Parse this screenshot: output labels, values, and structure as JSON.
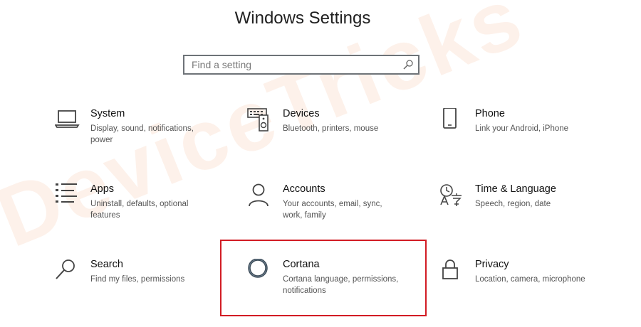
{
  "window": {
    "title": "Windows Settings"
  },
  "search": {
    "placeholder": "Find a setting",
    "icon": "search-icon"
  },
  "watermark": "DeviceTricks",
  "tiles": [
    {
      "name": "System",
      "desc": "Display, sound, notifications, power",
      "icon": "laptop-icon"
    },
    {
      "name": "Devices",
      "desc": "Bluetooth, printers, mouse",
      "icon": "keyboard-speaker-icon"
    },
    {
      "name": "Phone",
      "desc": "Link your Android, iPhone",
      "icon": "phone-icon"
    },
    {
      "name": "Apps",
      "desc": "Uninstall, defaults, optional features",
      "icon": "apps-list-icon"
    },
    {
      "name": "Accounts",
      "desc": "Your accounts, email, sync, work, family",
      "icon": "person-icon"
    },
    {
      "name": "Time & Language",
      "desc": "Speech, region, date",
      "icon": "time-language-icon"
    },
    {
      "name": "Search",
      "desc": "Find my files, permissions",
      "icon": "magnifier-icon"
    },
    {
      "name": "Cortana",
      "desc": "Cortana language, permissions, notifications",
      "icon": "cortana-ring-icon"
    },
    {
      "name": "Privacy",
      "desc": "Location, camera, microphone",
      "icon": "lock-icon"
    }
  ],
  "highlighted_tile": "Cortana",
  "colors": {
    "highlight_border": "#d21c24",
    "icon_stroke": "#444444",
    "cortana_ring": "#3b4a57"
  }
}
